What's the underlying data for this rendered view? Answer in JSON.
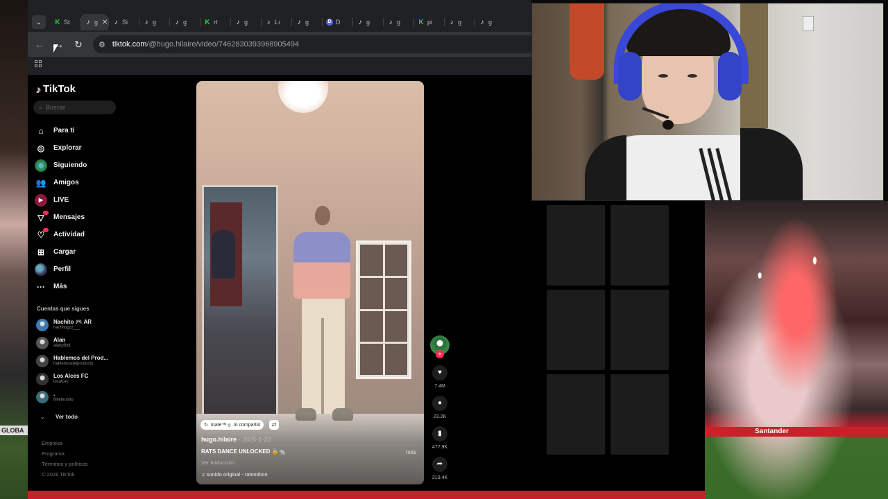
{
  "browser": {
    "tabs": [
      {
        "icon": "kick-icon",
        "glyph": "K",
        "label": "St",
        "active": false
      },
      {
        "icon": "tiktok-icon",
        "glyph": "♪",
        "label": "ɡ",
        "active": true
      },
      {
        "icon": "tiktok-icon",
        "glyph": "♪",
        "label": "Si",
        "active": false
      },
      {
        "icon": "tiktok-icon",
        "glyph": "♪",
        "label": "ɡ",
        "active": false
      },
      {
        "icon": "tiktok-icon",
        "glyph": "♪",
        "label": "ɡ",
        "active": false
      },
      {
        "icon": "kick-icon",
        "glyph": "K",
        "label": "rt",
        "active": false
      },
      {
        "icon": "tiktok-icon",
        "glyph": "♪",
        "label": "ɡ",
        "active": false
      },
      {
        "icon": "tiktok-icon",
        "glyph": "♪",
        "label": "Lı",
        "active": false
      },
      {
        "icon": "tiktok-icon",
        "glyph": "♪",
        "label": "ɡ",
        "active": false
      },
      {
        "icon": "discord-icon",
        "glyph": "D",
        "label": "D",
        "active": false
      },
      {
        "icon": "tiktok-icon",
        "glyph": "♪",
        "label": "ɡ",
        "active": false
      },
      {
        "icon": "tiktok-icon",
        "glyph": "♪",
        "label": "ɡ",
        "active": false
      },
      {
        "icon": "kick-icon",
        "glyph": "K",
        "label": "pi",
        "active": false
      },
      {
        "icon": "tiktok-icon",
        "glyph": "♪",
        "label": "ɡ",
        "active": false
      },
      {
        "icon": "tiktok-icon",
        "glyph": "♪",
        "label": "ɡ",
        "active": false
      }
    ],
    "url_host": "tiktok.com",
    "url_path": "/@hugo.hilaire/video/7462830393968905494"
  },
  "tiktok": {
    "logo": "TikTok",
    "search_placeholder": "Buscar",
    "nav": [
      {
        "label": "Para ti",
        "icon": "home-icon",
        "glyph": "⌂"
      },
      {
        "label": "Explorar",
        "icon": "compass-icon",
        "glyph": "◎"
      },
      {
        "label": "Siguiendo",
        "icon": "following-avatar-icon",
        "glyph": ""
      },
      {
        "label": "Amigos",
        "icon": "friends-icon",
        "glyph": "👥"
      },
      {
        "label": "LIVE",
        "icon": "live-icon",
        "glyph": "▶"
      },
      {
        "label": "Mensajes",
        "icon": "messages-icon",
        "glyph": "▽"
      },
      {
        "label": "Actividad",
        "icon": "activity-icon",
        "glyph": "♡"
      },
      {
        "label": "Cargar",
        "icon": "upload-icon",
        "glyph": "⊞"
      },
      {
        "label": "Perfil",
        "icon": "profile-avatar-icon",
        "glyph": ""
      },
      {
        "label": "Más",
        "icon": "more-icon",
        "glyph": "···"
      }
    ],
    "following_title": "Cuentas que sigues",
    "following": [
      {
        "name": "Nachito 🎮 AR",
        "handle": "nachitogzz___",
        "color": "#3a7ab0"
      },
      {
        "name": "Alan",
        "handle": "alanpfbdt",
        "color": "#555555"
      },
      {
        "name": "Hablemos del Prod...",
        "handle": "hablemosdelproducto",
        "color": "#444444"
      },
      {
        "name": "Los Alces FC",
        "handle": "losalces",
        "color": "#333333"
      },
      {
        "name": ".",
        "handle": "littlebrosito",
        "color": "#3a6a7a"
      }
    ],
    "see_all": "Ver todo",
    "footer": [
      "Empresa",
      "Programa",
      "Términos y políticas",
      "© 2026 TikTok"
    ],
    "video": {
      "pill_text": "mate™🍵 lo compartió",
      "author": "hugo.hilaire",
      "date": "· 2025-1-22",
      "caption": "RATS DANCE UNLOCKED 🔓🐀",
      "more": "más",
      "translate": "Ver traducción",
      "sound": "sonido original - ratomilton"
    },
    "actions": {
      "likes": "7.4M",
      "comments": "23.2K",
      "saves": "477.9K",
      "shares": "219.4K"
    }
  },
  "background": {
    "left_sponsor": "GLOBA",
    "right_sponsor": "Santander"
  }
}
